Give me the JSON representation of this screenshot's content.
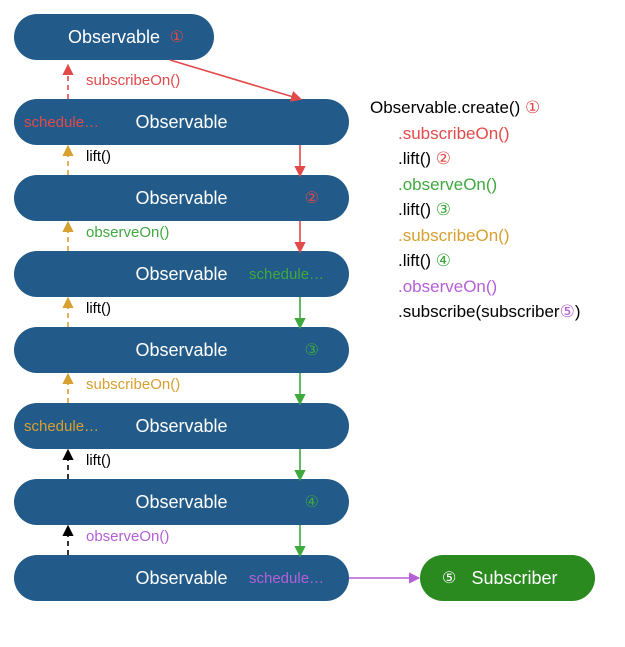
{
  "nodes": {
    "top": {
      "label": "Observable",
      "badge": "①",
      "badge_color": "#e24a4a"
    },
    "r2": {
      "label": "Observable",
      "sched": "schedule…",
      "sched_color": "#e24a4a"
    },
    "r3": {
      "label": "Observable",
      "badge": "②",
      "badge_color": "#e24a4a"
    },
    "r4": {
      "label": "Observable",
      "sched": "schedule…",
      "sched_color": "#3fa93f"
    },
    "r5": {
      "label": "Observable",
      "badge": "③",
      "badge_color": "#3fa93f"
    },
    "r6": {
      "label": "Observable",
      "sched": "schedule…",
      "sched_color": "#d8a030"
    },
    "r7": {
      "label": "Observable",
      "badge": "④",
      "badge_color": "#3fa93f"
    },
    "r8": {
      "label": "Observable",
      "sched": "schedule…",
      "sched_color": "#b560d8"
    },
    "sub": {
      "label": "Subscriber",
      "badge": "⑤",
      "badge_color": "#b560d8"
    }
  },
  "edge_labels": {
    "e1": {
      "text": "subscribeOn()",
      "color": "#e24a4a"
    },
    "e2": {
      "text": "lift()",
      "color": "#000"
    },
    "e3": {
      "text": "observeOn()",
      "color": "#3fa93f"
    },
    "e4": {
      "text": "lift()",
      "color": "#000"
    },
    "e5": {
      "text": "subscribeOn()",
      "color": "#d8a030"
    },
    "e6": {
      "text": "lift()",
      "color": "#000"
    },
    "e7": {
      "text": "observeOn()",
      "color": "#b560d8"
    }
  },
  "code": {
    "l1a": "Observable.create() ",
    "l1b": "①",
    "l1b_color": "#e24a4a",
    "l2": ".subscribeOn()",
    "l2_color": "#e24a4a",
    "l3a": ".lift() ",
    "l3b": "②",
    "l3b_color": "#e24a4a",
    "l4": ".observeOn()",
    "l4_color": "#3fa93f",
    "l5a": ".lift() ",
    "l5b": "③",
    "l5b_color": "#3fa93f",
    "l6": ".subscribeOn()",
    "l6_color": "#d8a030",
    "l7a": ".lift() ",
    "l7b": "④",
    "l7b_color": "#3fa93f",
    "l8": ".observeOn()",
    "l8_color": "#b560d8",
    "l9a": ".subscribe(subscriber",
    "l9b": "⑤",
    "l9b_color": "#b560d8",
    "l9c": ")"
  },
  "arrow_colors": {
    "red": "#e24a4a",
    "green": "#3fa93f",
    "gold": "#d8a030",
    "purple": "#b560d8",
    "black": "#000"
  }
}
